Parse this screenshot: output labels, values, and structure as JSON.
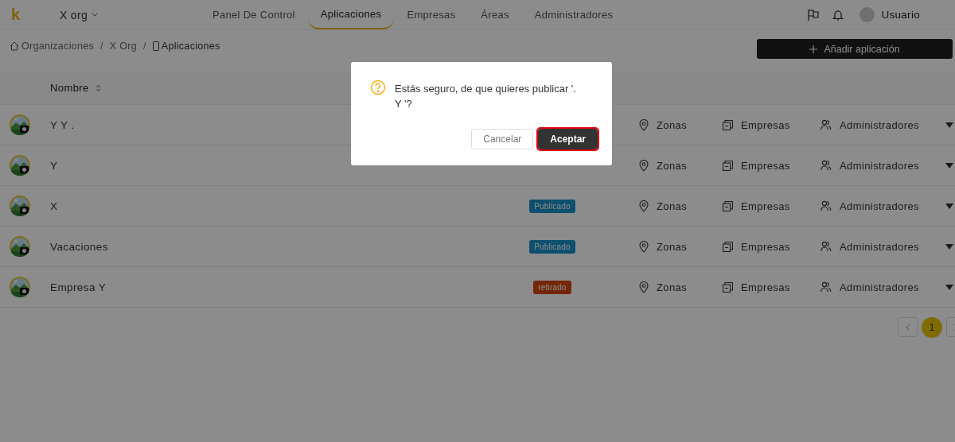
{
  "header": {
    "logo": "k",
    "org": "X org",
    "nav": [
      {
        "label": "Panel De Control",
        "selected": false
      },
      {
        "label": "Aplicaciones",
        "selected": true
      },
      {
        "label": "Empresas",
        "selected": false
      },
      {
        "label": "Áreas",
        "selected": false
      },
      {
        "label": "Administradores",
        "selected": false
      }
    ],
    "user": "Usuario"
  },
  "breadcrumb": [
    {
      "label": "Organizaciones"
    },
    {
      "separator": "/",
      "label": "X Org"
    },
    {
      "separator": "/",
      "label": "Aplicaciones"
    }
  ],
  "add_button": "Añadir aplicación",
  "table": {
    "columns": [
      "Nombre"
    ],
    "rows": [
      {
        "name": "Y Y .",
        "zones": "Zonas",
        "companies": "Empresas",
        "admins": "Administradores"
      },
      {
        "name": "Y",
        "zones": "Zonas",
        "companies": "Empresas",
        "admins": "Administradores"
      },
      {
        "name": "X",
        "status": {
          "label": "Publicado",
          "kind": "published"
        },
        "zones": "Zonas",
        "companies": "Empresas",
        "admins": "Administradores"
      },
      {
        "name": "Vacaciones",
        "status": {
          "label": "Publicado",
          "kind": "published"
        },
        "zones": "Zonas",
        "companies": "Empresas",
        "admins": "Administradores"
      },
      {
        "name": "Empresa Y",
        "status": {
          "label": "retirado",
          "kind": "retired"
        },
        "zones": "Zonas",
        "companies": "Empresas",
        "admins": "Administradores"
      }
    ]
  },
  "pagination": {
    "pages": [
      {
        "label": "1",
        "selected": true
      }
    ]
  },
  "dialog": {
    "message": "Estás seguro, de que quieres publicar '.\nY '?",
    "buttons": [
      {
        "label": "Cancelar",
        "kind": "default",
        "focused": false
      },
      {
        "label": "Aceptar",
        "kind": "primary",
        "focused": true
      }
    ]
  }
}
